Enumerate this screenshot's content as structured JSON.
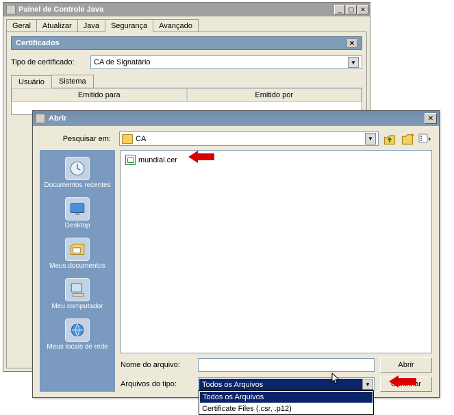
{
  "bg": {
    "title": "Painel de Controle Java",
    "tabs": [
      "Geral",
      "Atualizar",
      "Java",
      "Segurança",
      "Avançado"
    ],
    "active_tab_index": 3,
    "cert_heading": "Certificados",
    "cert_type_label": "Tipo de certificado:",
    "cert_type_value": "CA de Signatário",
    "sub_tabs": [
      "Usuário",
      "Sistema"
    ],
    "active_sub_tab_index": 0,
    "table_headers": [
      "Emitido para",
      "Emitido por"
    ]
  },
  "fg": {
    "title": "Abrir",
    "search_label": "Pesquisar em:",
    "folder_name": "CA",
    "places": [
      "Documentos recentes",
      "Desktop",
      "Meus documentos",
      "Meu computador",
      "Meus locais de rede"
    ],
    "file_item": "mundial.cer",
    "filename_label": "Nome do arquivo:",
    "filename_value": "",
    "filetype_label": "Arquivos do tipo:",
    "filetype_selected": "Todos os Arquivos",
    "filetype_options": [
      "Todos os Arquivos",
      "Certificate Files (.csr, .p12)"
    ],
    "btn_open": "Abrir",
    "btn_cancel": "Cancelar"
  }
}
